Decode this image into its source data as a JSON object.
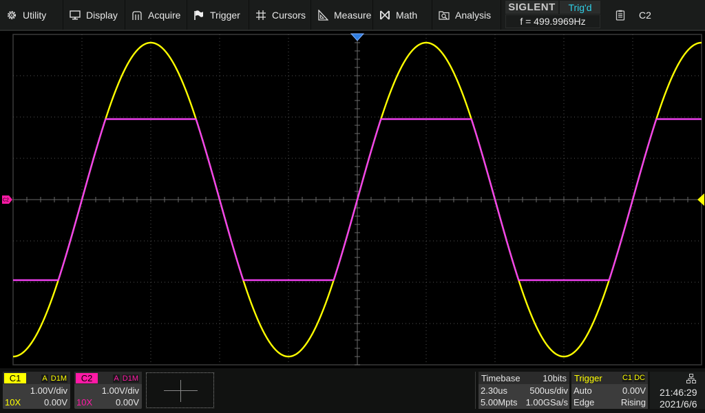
{
  "menu": {
    "items": [
      {
        "label": "Utility",
        "icon": "gear-icon"
      },
      {
        "label": "Display",
        "icon": "monitor-icon"
      },
      {
        "label": "Acquire",
        "icon": "acquire-icon"
      },
      {
        "label": "Trigger",
        "icon": "flag-icon"
      },
      {
        "label": "Cursors",
        "icon": "cursors-grid-icon"
      },
      {
        "label": "Measure",
        "icon": "ruler-triangle-icon"
      },
      {
        "label": "Math",
        "icon": "math-icon"
      },
      {
        "label": "Analysis",
        "icon": "analysis-icon"
      }
    ],
    "brand": "SIGLENT",
    "trigger_state": "Trig'd",
    "frequency": "f = 499.9969Hz",
    "right_menu": {
      "icon": "clipboard-icon",
      "label": "C2"
    }
  },
  "colors": {
    "ch1": "#ffff00",
    "ch2": "#ff1aa6",
    "ch2_trace": "#f040f0",
    "trigger_marker": "#2f7de0",
    "trig_state": "#2fd0e8"
  },
  "waveform": {
    "grid": {
      "h_divs": 10,
      "v_divs": 8
    },
    "ch1": {
      "shape": "sine",
      "amplitude_v": 3.8,
      "frequency_hz": 500,
      "phase_at_center": "rising-zero-crossing"
    },
    "ch2": {
      "shape": "clipped-sine",
      "amplitude_v": 3.8,
      "clip_v": 1.95,
      "frequency_hz": 500
    },
    "markers": {
      "ch2_offset_label": "C2",
      "trigger_position": "center",
      "trigger_level_v": 0.0
    }
  },
  "channels": [
    {
      "name": "C1",
      "coupling": "A",
      "impedance": "D1M",
      "scale": "1.00V/div",
      "probe": "10X",
      "offset": "0.00V"
    },
    {
      "name": "C2",
      "coupling": "A",
      "impedance": "D1M",
      "scale": "1.00V/div",
      "probe": "10X",
      "offset": "0.00V"
    }
  ],
  "timebase": {
    "title": "Timebase",
    "bits": "10bits",
    "delay": "2.30us",
    "scale": "500us/div",
    "memory": "5.00Mpts",
    "sample_rate": "1.00GSa/s"
  },
  "trigger": {
    "title": "Trigger",
    "source": "C1",
    "coupling": "DC",
    "mode": "Auto",
    "level": "0.00V",
    "type": "Edge",
    "slope": "Rising"
  },
  "clock": {
    "time": "21:46:29",
    "date": "2021/6/6",
    "icon": "network-icon"
  }
}
